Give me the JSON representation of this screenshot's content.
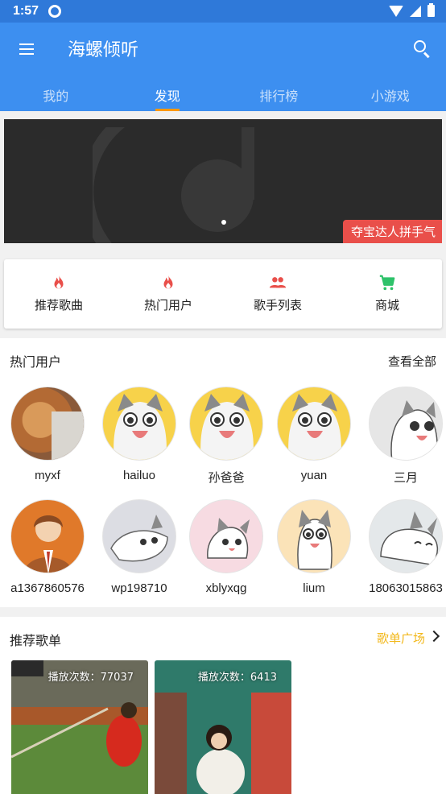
{
  "status_bar": {
    "time": "1:57"
  },
  "app_bar": {
    "title": "海螺倾听",
    "tabs": [
      {
        "label": "我的"
      },
      {
        "label": "发现",
        "active": true
      },
      {
        "label": "排行榜"
      },
      {
        "label": "小游戏"
      }
    ]
  },
  "banner": {
    "tag": "夺宝达人拼手气",
    "dots": 1
  },
  "quick_menu": [
    {
      "label": "推荐歌曲",
      "icon": "flame-icon"
    },
    {
      "label": "热门用户",
      "icon": "flame-icon"
    },
    {
      "label": "歌手列表",
      "icon": "people-icon"
    },
    {
      "label": "商城",
      "icon": "cart-icon"
    }
  ],
  "hot_users": {
    "title": "热门用户",
    "more": "查看全部",
    "users": [
      {
        "name": "myxf"
      },
      {
        "name": "hailuo"
      },
      {
        "name": "孙爸爸"
      },
      {
        "name": "yuan"
      },
      {
        "name": "三月"
      },
      {
        "name": "a1367860576"
      },
      {
        "name": "wp198710"
      },
      {
        "name": "xblyxqg"
      },
      {
        "name": "lium"
      },
      {
        "name": "18063015863"
      }
    ]
  },
  "song_lists": {
    "title": "推荐歌单",
    "more": "歌单广场",
    "playlists": [
      {
        "play_count": "播放次数：77037"
      },
      {
        "play_count": "播放次数：6413"
      }
    ]
  },
  "colors": {
    "primary": "#3d8ff0",
    "status_bar": "#2f79d9",
    "tab_indicator": "#ff9800",
    "accent_red": "#e94f4a",
    "accent_green": "#2ec26a",
    "link_yellow": "#f2b81c"
  }
}
